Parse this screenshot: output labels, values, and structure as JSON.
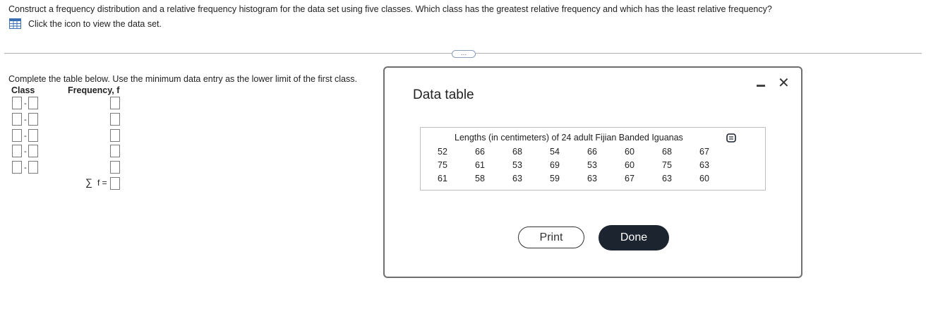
{
  "question": {
    "text": "Construct a frequency distribution and a relative frequency histogram for the data set using five classes. Which class has the greatest relative frequency and which has the least relative frequency?"
  },
  "dataset_link": {
    "icon": "table-grid-icon",
    "text": "Click the icon to view the data set."
  },
  "more_button": {
    "label": "…"
  },
  "form": {
    "instruction": "Complete the table below. Use the minimum data entry as the lower limit of the first class.",
    "class_header": "Class",
    "frequency_header": "Frequency, f",
    "rows": [
      {
        "lower": "",
        "upper": "",
        "frequency": ""
      },
      {
        "lower": "",
        "upper": "",
        "frequency": ""
      },
      {
        "lower": "",
        "upper": "",
        "frequency": ""
      },
      {
        "lower": "",
        "upper": "",
        "frequency": ""
      },
      {
        "lower": "",
        "upper": "",
        "frequency": ""
      }
    ],
    "range_separator": "-",
    "sum_symbol": "∑",
    "sum_label": "f =",
    "sum_value": ""
  },
  "modal": {
    "title": "Data table",
    "caption": "Lengths (in centimeters) of 24 adult Fijian Banded Iguanas",
    "rows": [
      [
        "52",
        "66",
        "68",
        "54",
        "66",
        "60",
        "68",
        "67"
      ],
      [
        "75",
        "61",
        "53",
        "69",
        "53",
        "60",
        "75",
        "63"
      ],
      [
        "61",
        "58",
        "63",
        "59",
        "63",
        "67",
        "63",
        "60"
      ]
    ],
    "copy_icon": "copy-icon",
    "print_label": "Print",
    "done_label": "Done"
  },
  "colors": {
    "done_button": "#1c2430",
    "icon_blue": "#3a6fb5"
  }
}
